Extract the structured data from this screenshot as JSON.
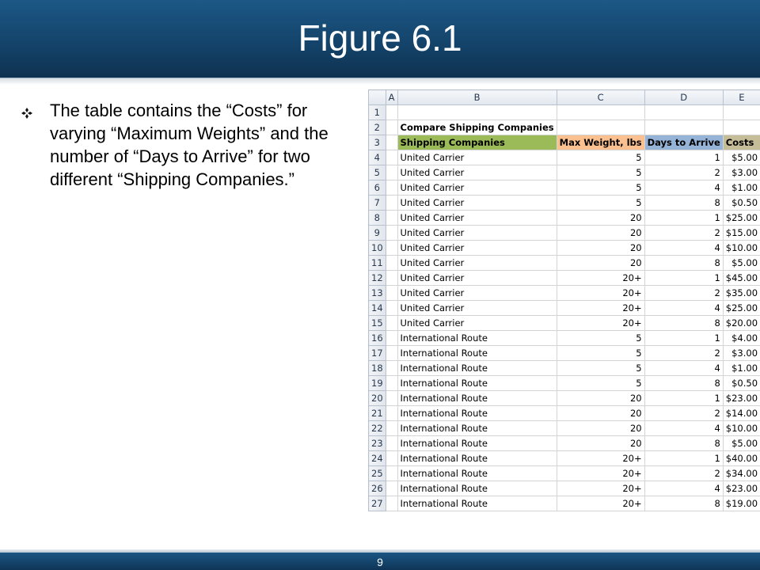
{
  "slide": {
    "title": "Figure 6.1",
    "bullet_text": "The table contains the “Costs” for varying “Maximum Weights” and the number of “Days to Arrive” for two different “Shipping Companies.”",
    "page_number": "9"
  },
  "spreadsheet": {
    "column_headers": [
      "A",
      "B",
      "C",
      "D",
      "E"
    ],
    "row_numbers": [
      "1",
      "2",
      "3",
      "4",
      "5",
      "6",
      "7",
      "8",
      "9",
      "10",
      "11",
      "12",
      "13",
      "14",
      "15",
      "16",
      "17",
      "18",
      "19",
      "20",
      "21",
      "22",
      "23",
      "24",
      "25",
      "26",
      "27"
    ],
    "caption": "Compare Shipping Companies",
    "table_headers": [
      "Shipping Companies",
      "Max Weight, lbs",
      "Days to Arrive",
      "Costs"
    ],
    "header_colors": [
      "#9bbb59",
      "#fac090",
      "#95b3d7",
      "#c4bd97"
    ],
    "rows": [
      [
        "United Carrier",
        "5",
        "1",
        "$5.00"
      ],
      [
        "United Carrier",
        "5",
        "2",
        "$3.00"
      ],
      [
        "United Carrier",
        "5",
        "4",
        "$1.00"
      ],
      [
        "United Carrier",
        "5",
        "8",
        "$0.50"
      ],
      [
        "United Carrier",
        "20",
        "1",
        "$25.00"
      ],
      [
        "United Carrier",
        "20",
        "2",
        "$15.00"
      ],
      [
        "United Carrier",
        "20",
        "4",
        "$10.00"
      ],
      [
        "United Carrier",
        "20",
        "8",
        "$5.00"
      ],
      [
        "United Carrier",
        "20+",
        "1",
        "$45.00"
      ],
      [
        "United Carrier",
        "20+",
        "2",
        "$35.00"
      ],
      [
        "United Carrier",
        "20+",
        "4",
        "$25.00"
      ],
      [
        "United Carrier",
        "20+",
        "8",
        "$20.00"
      ],
      [
        "International Route",
        "5",
        "1",
        "$4.00"
      ],
      [
        "International Route",
        "5",
        "2",
        "$3.00"
      ],
      [
        "International Route",
        "5",
        "4",
        "$1.00"
      ],
      [
        "International Route",
        "5",
        "8",
        "$0.50"
      ],
      [
        "International Route",
        "20",
        "1",
        "$23.00"
      ],
      [
        "International Route",
        "20",
        "2",
        "$14.00"
      ],
      [
        "International Route",
        "20",
        "4",
        "$10.00"
      ],
      [
        "International Route",
        "20",
        "8",
        "$5.00"
      ],
      [
        "International Route",
        "20+",
        "1",
        "$40.00"
      ],
      [
        "International Route",
        "20+",
        "2",
        "$34.00"
      ],
      [
        "International Route",
        "20+",
        "4",
        "$23.00"
      ],
      [
        "International Route",
        "20+",
        "8",
        "$19.00"
      ]
    ]
  },
  "colors": {
    "header_bar": "#14446b",
    "title_text": "#ffffff"
  },
  "icons": {
    "bullet": "diamond-bullet-icon"
  }
}
